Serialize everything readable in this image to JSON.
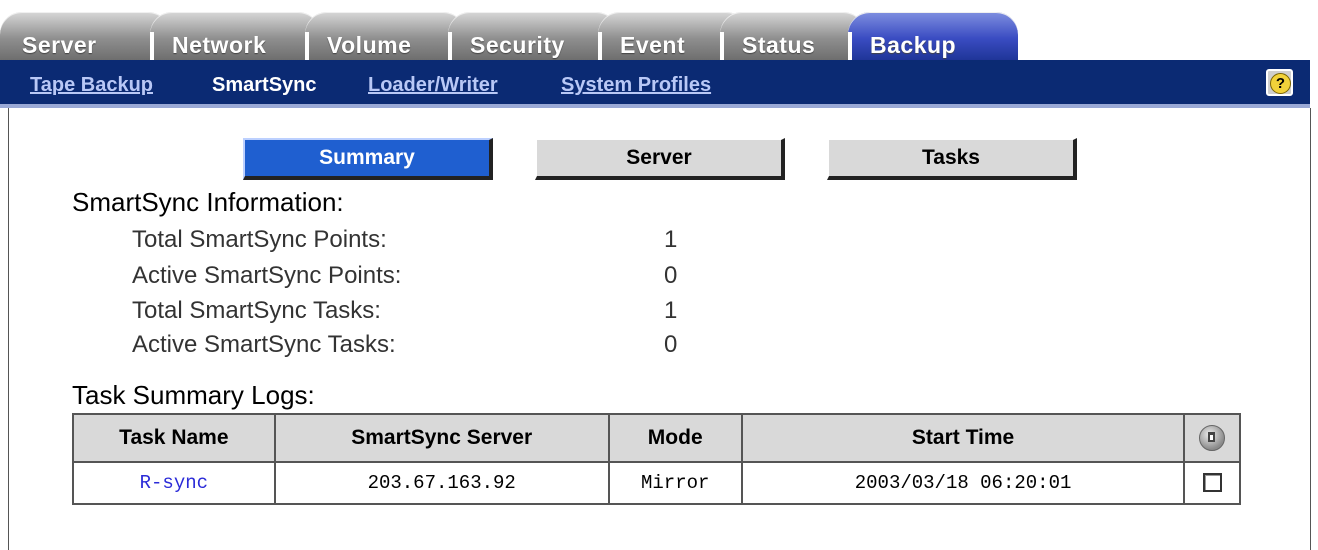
{
  "tabs": [
    {
      "label": "Server"
    },
    {
      "label": "Network"
    },
    {
      "label": "Volume"
    },
    {
      "label": "Security"
    },
    {
      "label": "Event"
    },
    {
      "label": "Status"
    },
    {
      "label": "Backup"
    }
  ],
  "active_tab": "Backup",
  "subnav": {
    "items": [
      "Tape Backup",
      "SmartSync",
      "Loader/Writer",
      "System Profiles"
    ],
    "current": "SmartSync",
    "help_label": "?"
  },
  "subtabs": {
    "summary": "Summary",
    "server": "Server",
    "tasks": "Tasks",
    "active": "Summary"
  },
  "info": {
    "title": "SmartSync Information:",
    "rows": [
      {
        "label": "Total SmartSync Points:",
        "value": "1"
      },
      {
        "label": "Active SmartSync Points:",
        "value": "0"
      },
      {
        "label": "Total SmartSync Tasks:",
        "value": "1"
      },
      {
        "label": "Active SmartSync Tasks:",
        "value": "0"
      }
    ]
  },
  "logs": {
    "title": "Task Summary Logs:",
    "headers": [
      "Task Name",
      "SmartSync Server",
      "Mode",
      "Start Time"
    ],
    "rows": [
      {
        "task": "R-sync",
        "server": "203.67.163.92",
        "mode": "Mirror",
        "start": "2003/03/18 06:20:01"
      }
    ]
  }
}
